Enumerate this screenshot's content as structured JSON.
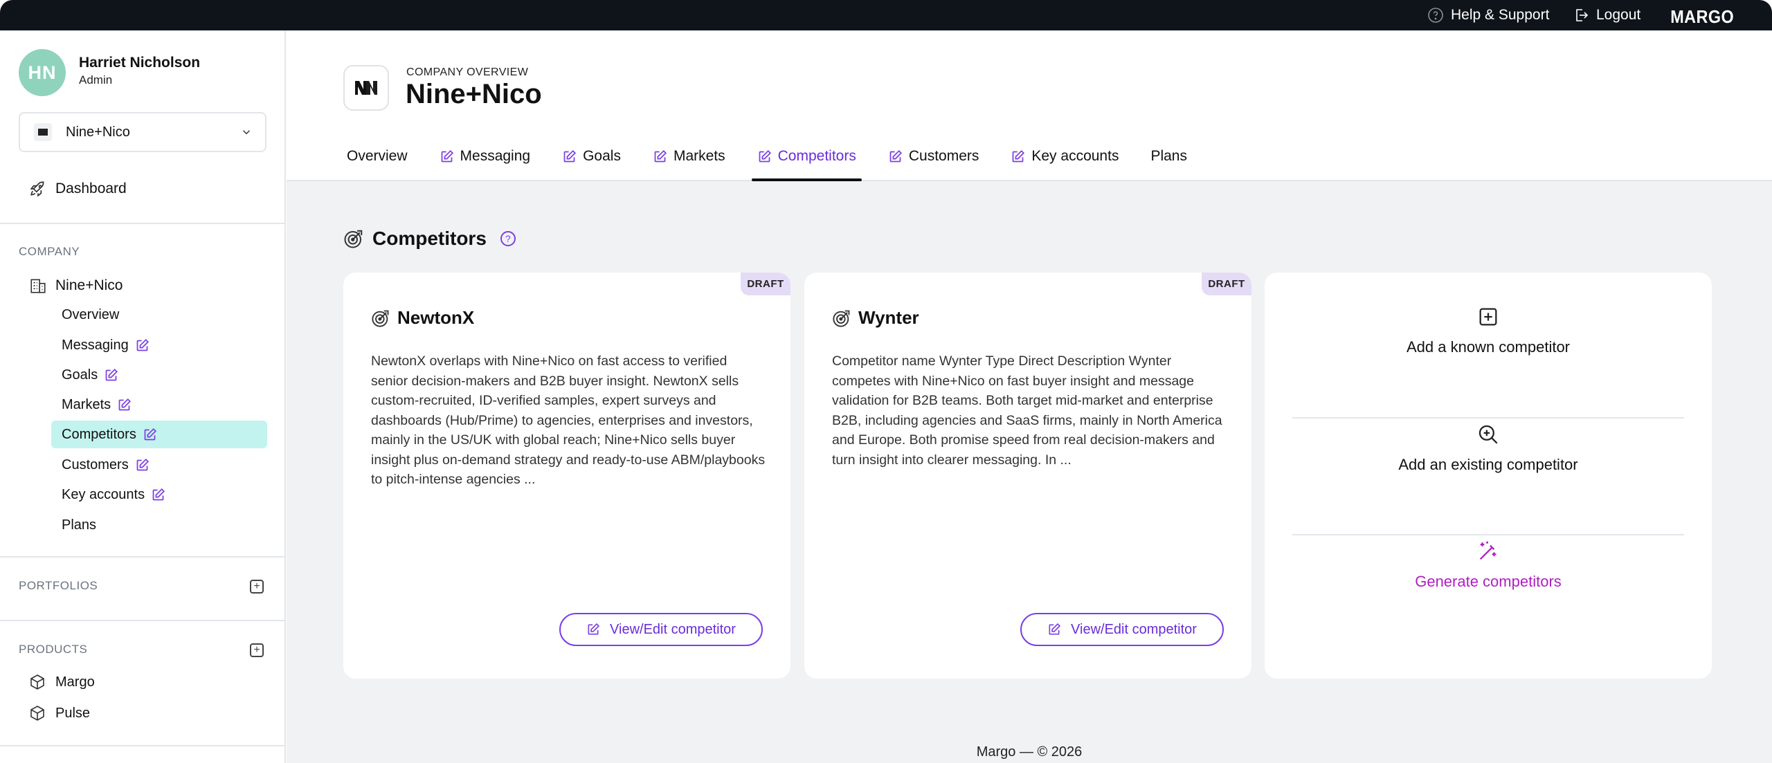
{
  "topbar": {
    "help_label": "Help & Support",
    "logout_label": "Logout",
    "brand": "MARGO"
  },
  "user": {
    "initials": "HN",
    "name": "Harriet Nicholson",
    "role": "Admin"
  },
  "company_select": {
    "value": "Nine+Nico"
  },
  "sidebar": {
    "dashboard_label": "Dashboard",
    "company_section_label": "COMPANY",
    "company_name": "Nine+Nico",
    "company_items": [
      {
        "label": "Overview",
        "editable": false
      },
      {
        "label": "Messaging",
        "editable": true
      },
      {
        "label": "Goals",
        "editable": true
      },
      {
        "label": "Markets",
        "editable": true
      },
      {
        "label": "Competitors",
        "editable": true,
        "active": true
      },
      {
        "label": "Customers",
        "editable": true
      },
      {
        "label": "Key accounts",
        "editable": true
      },
      {
        "label": "Plans",
        "editable": false
      }
    ],
    "portfolios_label": "PORTFOLIOS",
    "products_label": "PRODUCTS",
    "products": [
      "Margo",
      "Pulse"
    ]
  },
  "header": {
    "kicker": "COMPANY OVERVIEW",
    "title": "Nine+Nico",
    "tabs": [
      {
        "label": "Overview",
        "editable": false
      },
      {
        "label": "Messaging",
        "editable": true
      },
      {
        "label": "Goals",
        "editable": true
      },
      {
        "label": "Markets",
        "editable": true
      },
      {
        "label": "Competitors",
        "editable": true,
        "active": true
      },
      {
        "label": "Customers",
        "editable": true
      },
      {
        "label": "Key accounts",
        "editable": true
      },
      {
        "label": "Plans",
        "editable": false
      }
    ]
  },
  "section": {
    "title": "Competitors",
    "help": "?"
  },
  "competitors": [
    {
      "badge": "DRAFT",
      "name": "NewtonX",
      "description": "NewtonX overlaps with Nine+Nico on fast access to verified senior decision-makers and B2B buyer insight. NewtonX sells custom-recruited, ID-verified samples, expert surveys and dashboards (Hub/Prime) to agencies, enterprises and investors, mainly in the US/UK with global reach; Nine+Nico sells buyer insight plus on-demand strategy and ready-to-use ABM/playbooks to pitch-intense agencies ...",
      "button_label": "View/Edit competitor"
    },
    {
      "badge": "DRAFT",
      "name": "Wynter",
      "description": "Competitor name Wynter Type Direct Description Wynter competes with Nine+Nico on fast buyer insight and message validation for B2B teams. Both target mid-market and enterprise B2B, including agencies and SaaS firms, mainly in North America and Europe. Both promise speed from real decision-makers and turn insight into clearer messaging. In ...",
      "button_label": "View/Edit competitor"
    }
  ],
  "actions": {
    "add_known": "Add a known competitor",
    "add_existing": "Add an existing competitor",
    "generate": "Generate competitors"
  },
  "footer": {
    "text": "Margo — © 2026"
  },
  "colors": {
    "accent": "#6a2bd9",
    "generate": "#b11dc6",
    "active_nav_bg": "#c3f3ee",
    "topbar_bg": "#0e1419",
    "draft_badge_bg": "#e4dbf6"
  }
}
